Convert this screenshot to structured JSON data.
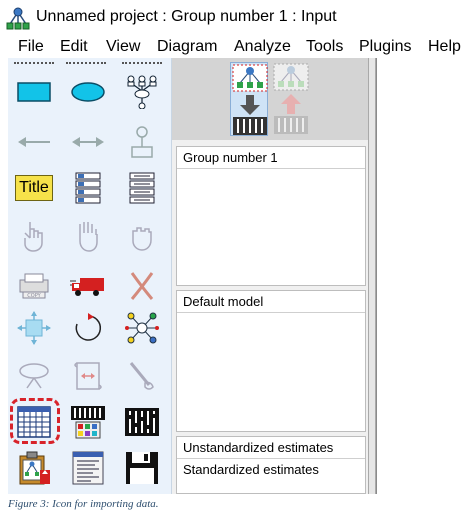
{
  "window": {
    "title": "Unnamed project : Group number 1 : Input",
    "icon": "network-tree-icon"
  },
  "menu": {
    "items": [
      "File",
      "Edit",
      "View",
      "Diagram",
      "Analyze",
      "Tools",
      "Plugins",
      "Help"
    ]
  },
  "toolbox": {
    "tools": [
      "draw-observed-variable",
      "draw-unobserved-variable",
      "draw-latent-variable-indicators",
      "draw-path",
      "draw-covariance",
      "draw-unique-variable",
      "figure-caption",
      "list-variables-in-model",
      "list-variables-in-dataset",
      "select-one-object",
      "select-all-objects",
      "deselect-all-objects",
      "duplicate-objects",
      "move-objects",
      "erase-objects",
      "change-shape-of-objects",
      "rotate-indicators",
      "reflect-indicators",
      "move-parameter-values",
      "scroll-diagram",
      "touch-up-variable",
      "select-data-files",
      "analysis-properties",
      "calculate-estimates",
      "copy-diagram-to-clipboard",
      "view-text",
      "save-diagram"
    ],
    "title_tool_label": "Title",
    "highlighted_tool": "select-data-files",
    "highlight_color": "#d8232a"
  },
  "view_toggle": {
    "input_view": "view-input-path-diagram",
    "output_view": "view-output-path-diagram"
  },
  "panels": {
    "groups": {
      "header": "Group number 1"
    },
    "models": {
      "header": "Default model"
    },
    "estimates": {
      "header": "Unstandardized estimates",
      "option": "Standardized estimates"
    }
  },
  "caption": "Figure 3: Icon for importing data."
}
